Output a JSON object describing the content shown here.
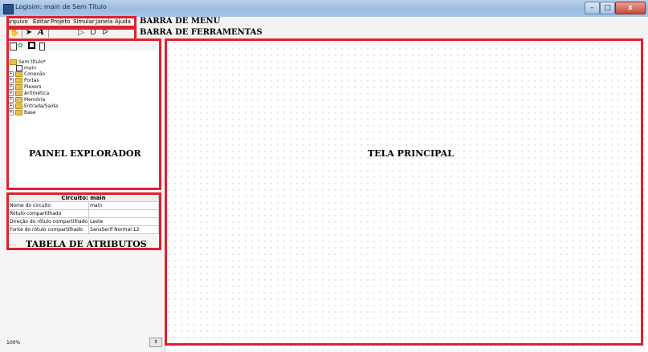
{
  "window": {
    "title": "Logisim: main de Sem Título",
    "controls": {
      "close": "x"
    }
  },
  "menu": {
    "items": [
      "Arquivo",
      "Editar",
      "Projeto",
      "Simular",
      "Janela",
      "Ajuda"
    ]
  },
  "toolbar": {
    "tools": [
      "hand-icon",
      "select-arrow-icon",
      "text-tool-icon",
      "input-pin-icon",
      "output-pin-icon",
      "not-gate-icon",
      "and-gate-icon",
      "or-gate-icon"
    ]
  },
  "explorer": {
    "root": "Sem título*",
    "main": "main",
    "folders": [
      "Conexão",
      "Portas",
      "Plexers",
      "Aritmética",
      "Memória",
      "Entrada/Saída",
      "Base"
    ]
  },
  "attributes": {
    "header": "Circuito: main",
    "rows": [
      {
        "name": "Nome do circuito",
        "value": "main"
      },
      {
        "name": "Rótulo compartilhado",
        "value": ""
      },
      {
        "name": "Direção do rótulo compartilhado",
        "value": "Leste"
      },
      {
        "name": "Fonte do rótulo compartilhado",
        "value": "SansSerif Normal 12"
      }
    ]
  },
  "status": {
    "zoom": "100%"
  },
  "annotations": {
    "menu_bar": "BARRA DE MENU",
    "toolbar": "BARRA DE FERRAMENTAS",
    "explorer": "PAINEL EXPLORADOR",
    "attributes": "TABELA DE ATRIBUTOS",
    "main_screen": "TELA PRINCIPAL"
  },
  "colors": {
    "highlight": "#e0202e",
    "titlebar": "#a8c5e8",
    "folder": "#e8c04e"
  }
}
